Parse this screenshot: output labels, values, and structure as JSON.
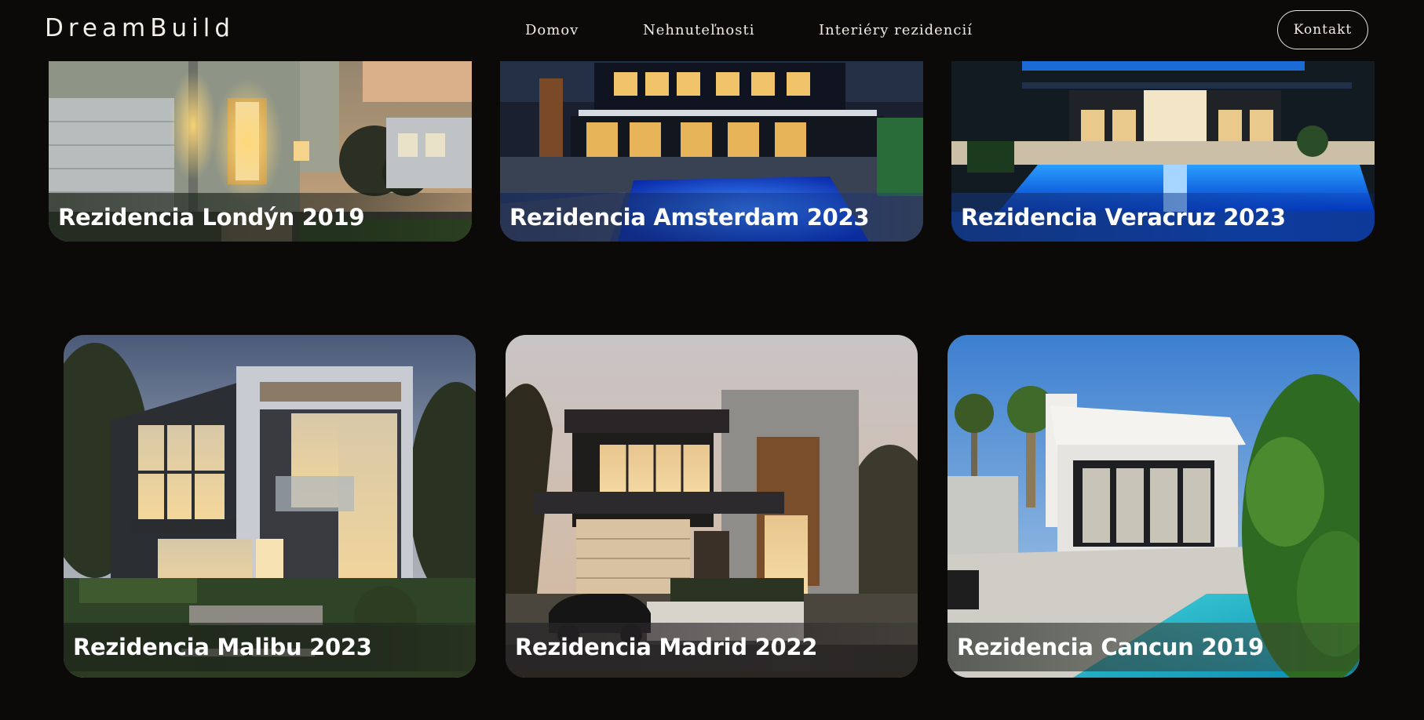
{
  "brand": {
    "logo": "DreamBuild"
  },
  "nav": {
    "items": [
      "Domov",
      "Nehnuteľnosti",
      "Interiéry rezidencií"
    ],
    "contact_label": "Kontakt"
  },
  "properties": [
    {
      "title": "Rezidencia Londýn 2019"
    },
    {
      "title": "Rezidencia Amsterdam 2023"
    },
    {
      "title": "Rezidencia Veracruz 2023"
    },
    {
      "title": "Rezidencia Malibu 2023"
    },
    {
      "title": "Rezidencia Madrid 2022"
    },
    {
      "title": "Rezidencia Cancun 2019"
    }
  ],
  "colors": {
    "background": "#0b0a09",
    "text": "#f0ece4",
    "caption_overlay": "#1e281c"
  }
}
